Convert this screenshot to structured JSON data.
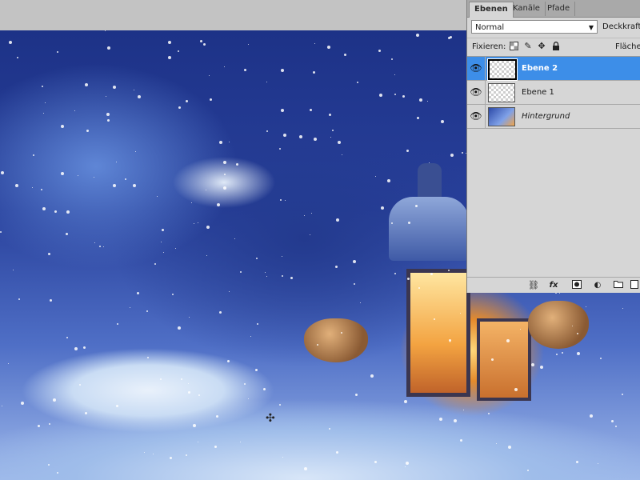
{
  "layers_panel": {
    "tabs": [
      {
        "label": "Ebenen",
        "active": true
      },
      {
        "label": "Kanäle",
        "active": false
      },
      {
        "label": "Pfade",
        "active": false
      }
    ],
    "blend_mode": "Normal",
    "opacity_label": "Deckkraft:",
    "fix_label": "Fixieren:",
    "fill_label": "Fläche:",
    "lock_icons": [
      "lock-transparent-pixels-icon",
      "lock-image-pixels-icon",
      "lock-position-icon",
      "lock-all-icon"
    ],
    "layers": [
      {
        "name": "Ebene 2",
        "selected": true,
        "visible": true,
        "thumbnail": "transparent"
      },
      {
        "name": "Ebene 1",
        "selected": false,
        "visible": true,
        "thumbnail": "transparent"
      },
      {
        "name": "Hintergrund",
        "selected": false,
        "visible": true,
        "thumbnail": "photo",
        "italic": true
      }
    ],
    "footer_icons": [
      "link-layers-icon",
      "layer-style-fx-icon",
      "layer-mask-icon",
      "adjustment-layer-icon",
      "new-group-icon",
      "new-layer-icon"
    ],
    "footer_fx_label": "fx"
  },
  "colors": {
    "panel_bg": "#d6d6d6",
    "selection": "#3d8ee8",
    "tab_bar": "#a9a9a9"
  }
}
